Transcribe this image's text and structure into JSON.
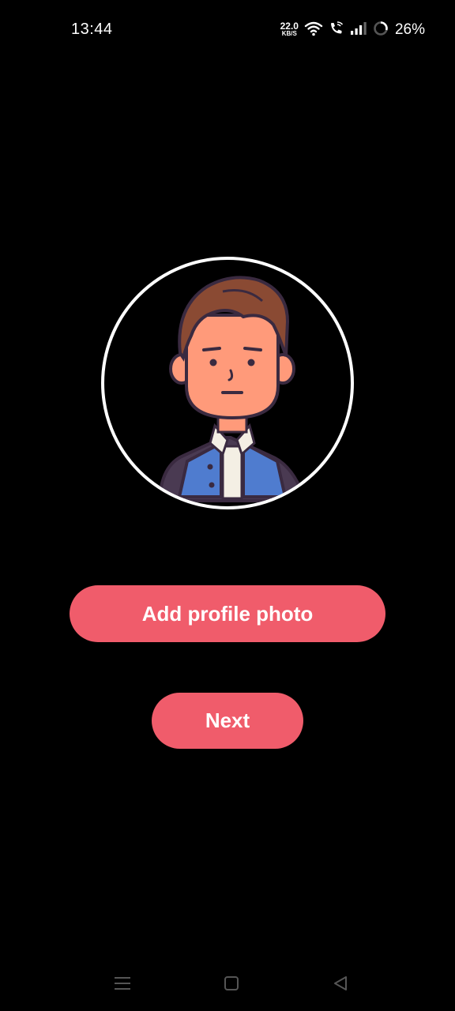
{
  "status_bar": {
    "time": "13:44",
    "net_speed_value": "22.0",
    "net_speed_unit": "KB/S",
    "battery_percent": "26%",
    "icons": [
      "wifi-icon",
      "wifi-call-icon",
      "signal-icon",
      "battery-ring-icon"
    ]
  },
  "profile": {
    "avatar_icon": "cartoon-boy-avatar"
  },
  "buttons": {
    "add_photo_label": "Add profile photo",
    "next_label": "Next"
  },
  "nav_bar": {
    "icons": [
      "menu-icon",
      "home-square-icon",
      "back-triangle-icon"
    ]
  },
  "colors": {
    "background": "#000000",
    "accent": "#f05c6b",
    "text": "#ffffff"
  }
}
